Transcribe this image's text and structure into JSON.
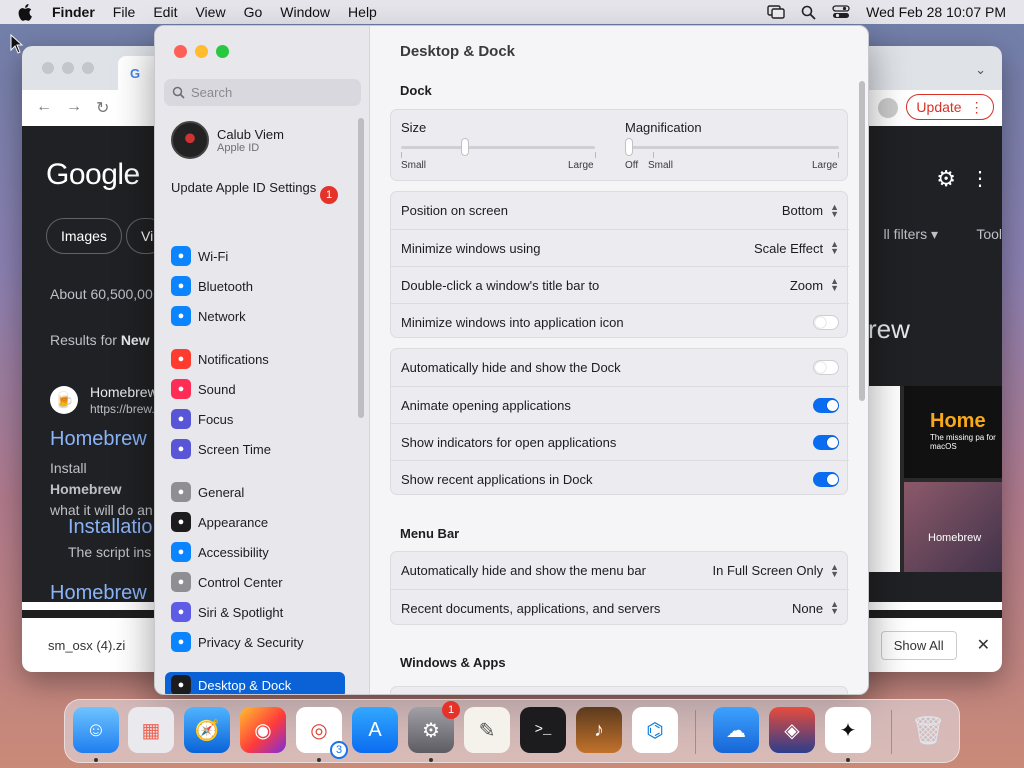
{
  "menubar": {
    "app": "Finder",
    "items": [
      "File",
      "Edit",
      "View",
      "Go",
      "Window",
      "Help"
    ],
    "datetime": "Wed Feb 28  10:07 PM"
  },
  "chrome": {
    "update_label": "Update",
    "google_logo": "Google",
    "chip_images": "Images",
    "chip_next": "Vi",
    "all_filters": "ll filters ▾",
    "tools": "Tool",
    "about": "About 60,500,00",
    "results_prefix": "Results for ",
    "results_bold": "New",
    "site_name": "Homebrew",
    "site_url": "https://brew.",
    "link1": "Homebrew",
    "snippet1_a": "Install ",
    "snippet1_b": "Homebrew",
    "snippet1_c": "what it will do an",
    "link2": "Installatio",
    "snippet2": "The script ins",
    "link3": "Homebrew",
    "brew_heading": "rew",
    "img_home": "Home",
    "img_home_sub": "The missing pa for macOS",
    "img_brew": "Homebrew",
    "download_file": "sm_osx (4).zi",
    "show_all": "Show All"
  },
  "sidebar": {
    "search_placeholder": "Search",
    "user_name": "Calub Viem",
    "user_sub": "Apple ID",
    "update_text": "Update Apple ID Settings",
    "update_badge": "1",
    "items": [
      {
        "label": "Wi-Fi",
        "icon": "wifi-icon",
        "color": "#0a84ff"
      },
      {
        "label": "Bluetooth",
        "icon": "bluetooth-icon",
        "color": "#0a84ff"
      },
      {
        "label": "Network",
        "icon": "globe-icon",
        "color": "#0a84ff"
      },
      {
        "label": "Notifications",
        "icon": "bell-icon",
        "color": "#ff3b30"
      },
      {
        "label": "Sound",
        "icon": "speaker-icon",
        "color": "#ff2d55"
      },
      {
        "label": "Focus",
        "icon": "moon-icon",
        "color": "#5856d6"
      },
      {
        "label": "Screen Time",
        "icon": "hourglass-icon",
        "color": "#5856d6"
      },
      {
        "label": "General",
        "icon": "gear-icon",
        "color": "#8e8e93"
      },
      {
        "label": "Appearance",
        "icon": "appearance-icon",
        "color": "#1c1c1e"
      },
      {
        "label": "Accessibility",
        "icon": "accessibility-icon",
        "color": "#0a84ff"
      },
      {
        "label": "Control Center",
        "icon": "control-center-icon",
        "color": "#8e8e93"
      },
      {
        "label": "Siri & Spotlight",
        "icon": "siri-icon",
        "color": "#5e5ce6"
      },
      {
        "label": "Privacy & Security",
        "icon": "hand-icon",
        "color": "#0a84ff"
      },
      {
        "label": "Desktop & Dock",
        "icon": "dock-icon",
        "color": "#1c1c1e"
      }
    ]
  },
  "content": {
    "title": "Desktop & Dock",
    "dock_section": "Dock",
    "size_label": "Size",
    "size_small": "Small",
    "size_large": "Large",
    "size_value": 0.33,
    "mag_label": "Magnification",
    "mag_off": "Off",
    "mag_small": "Small",
    "mag_large": "Large",
    "mag_value": 0.0,
    "position_label": "Position on screen",
    "position_value": "Bottom",
    "minimize_label": "Minimize windows using",
    "minimize_value": "Scale Effect",
    "dblclick_label": "Double-click a window's title bar to",
    "dblclick_value": "Zoom",
    "minimize_icon_label": "Minimize windows into application icon",
    "autohide_label": "Automatically hide and show the Dock",
    "animate_label": "Animate opening applications",
    "indicators_label": "Show indicators for open applications",
    "recent_label": "Show recent applications in Dock",
    "menubar_section": "Menu Bar",
    "menubar_autohide_label": "Automatically hide and show the menu bar",
    "menubar_autohide_value": "In Full Screen Only",
    "recent_docs_label": "Recent documents, applications, and servers",
    "recent_docs_value": "None",
    "windows_section": "Windows & Apps"
  },
  "toggles": {
    "minimize_icon": false,
    "autohide": false,
    "animate": true,
    "indicators": true,
    "recent": true
  },
  "dock": {
    "settings_badge": "1",
    "chrome_badge": "3"
  }
}
